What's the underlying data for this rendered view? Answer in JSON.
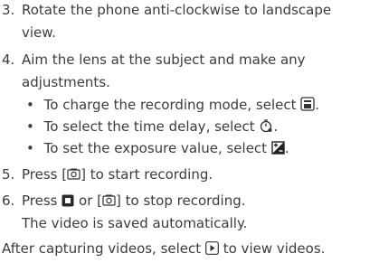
{
  "steps": {
    "s3_num": "3.",
    "s3_line1": "Rotate the phone anti-clockwise to landscape",
    "s3_line2": "view.",
    "s4_num": "4.",
    "s4_line1": "Aim the lens at the subject and make any",
    "s4_line2": "adjustments.",
    "s5_num": "5.",
    "s5_a": "Press [",
    "s5_b": "] to start recording.",
    "s6_num": "6.",
    "s6_a": "Press",
    "s6_b": "or [",
    "s6_c": "] to stop recording.",
    "s6_line2": "The video is saved automatically."
  },
  "bullets": [
    {
      "text": "To charge the recording mode, select",
      "icon": "recording-mode-icon",
      "end": "."
    },
    {
      "text": "To select the time delay, select",
      "icon": "timer-icon",
      "end": "."
    },
    {
      "text": "To set the exposure value, select",
      "icon": "exposure-icon",
      "end": "."
    }
  ],
  "footer": {
    "a": "After capturing videos, select",
    "b": "to view videos.",
    "icon": "play-icon"
  }
}
